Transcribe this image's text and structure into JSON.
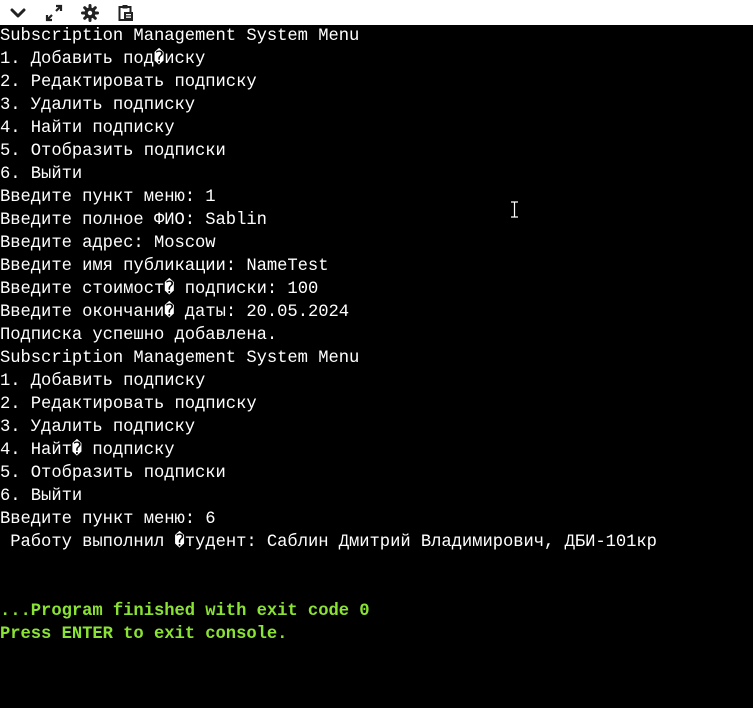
{
  "toolbar": {
    "buttons": [
      {
        "icon": "chevron-down-icon"
      },
      {
        "icon": "expand-icon"
      },
      {
        "icon": "gear-icon"
      },
      {
        "icon": "clipboard-icon"
      }
    ]
  },
  "console": {
    "lines": [
      "Subscription Management System Menu",
      "1. Добавить под�иску",
      "2. Редактировать подписку",
      "3. Удалить подписку",
      "4. Найти подписку",
      "5. Отобразить подписки",
      "6. Выйти",
      "Введите пункт меню: 1",
      "Введите полное ФИО: Sablin",
      "Введите адрес: Moscow",
      "Введите имя публикации: NameTest",
      "Введите стоимост� подписки: 100",
      "Введите окончани� даты: 20.05.2024",
      "Подписка успешно добавлена.",
      "Subscription Management System Menu",
      "1. Добавить подписку",
      "2. Редактировать подписку",
      "3. Удалить подписку",
      "4. Найт� подписку",
      "5. Отобразить подписки",
      "6. Выйти",
      "Введите пункт меню: 6",
      " Работу выполнил �тудент: Саблин Дмитрий Владимирович, ДБИ-101кр",
      "",
      "",
      "...Program finished with exit code 0",
      "Press ENTER to exit console."
    ],
    "colors": {
      "background": "#000000",
      "text": "#ffffff",
      "status": "#8ae234"
    }
  }
}
